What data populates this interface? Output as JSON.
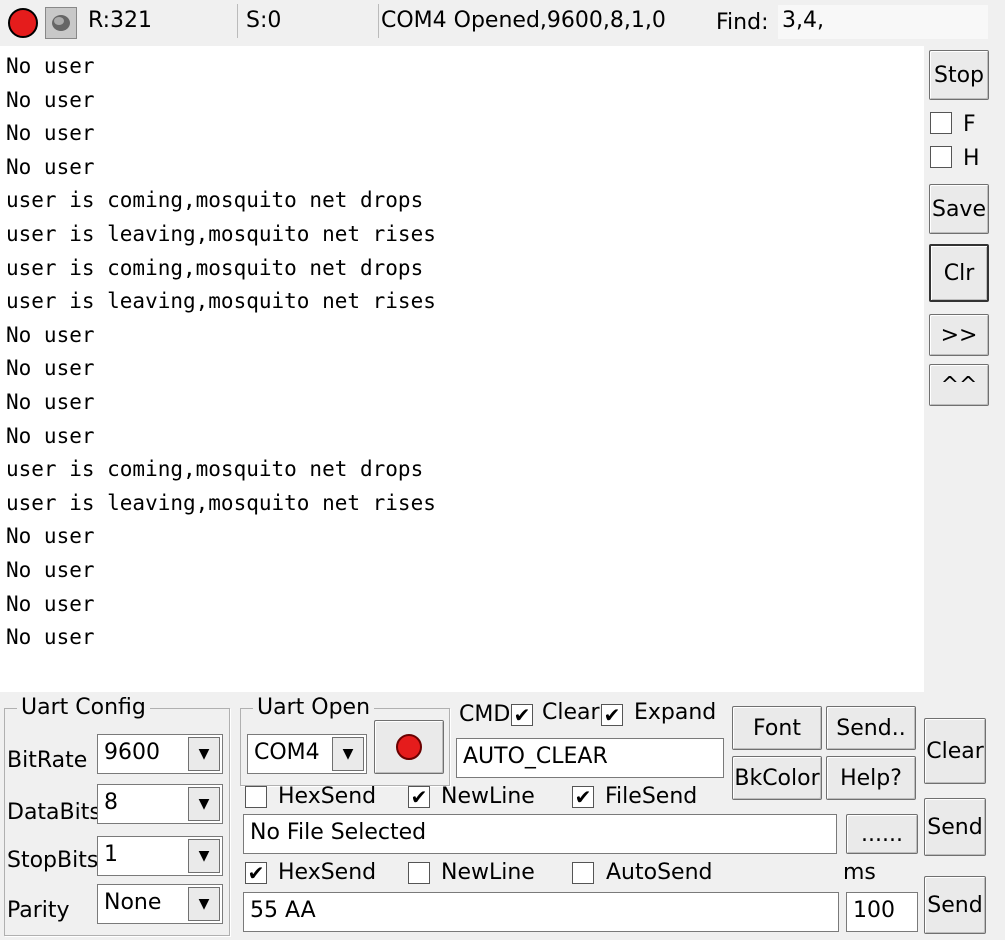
{
  "status_bar": {
    "received": "R:321",
    "sent": "S:0",
    "port_status": "COM4 Opened,9600,8,1,0",
    "find_label": "Find:",
    "find_value": "3,4,"
  },
  "log": {
    "lines": [
      "No user",
      "No user",
      "No user",
      "No user",
      "user is coming,mosquito net drops",
      "user is leaving,mosquito net rises",
      "user is coming,mosquito net drops",
      "user is leaving,mosquito net rises",
      "No user",
      "No user",
      "No user",
      "No user",
      "user is coming,mosquito net drops",
      "user is leaving,mosquito net rises",
      "No user",
      "No user",
      "No user",
      "No user"
    ]
  },
  "side_panel": {
    "stop_label": "Stop",
    "f_label": "F",
    "f_checked": false,
    "h_label": "H",
    "h_checked": false,
    "save_label": "Save",
    "clr_label": "Clr",
    "forward_label": ">>",
    "up_label": "^^"
  },
  "uart_config": {
    "title": "Uart Config",
    "bitrate_label": "BitRate",
    "bitrate_value": "9600",
    "databits_label": "DataBits",
    "databits_value": "8",
    "stopbits_label": "StopBits",
    "stopbits_value": "1",
    "parity_label": "Parity",
    "parity_value": "None"
  },
  "uart_open": {
    "title": "Uart Open",
    "port_value": "COM4"
  },
  "cmd": {
    "cmd_label": "CMD",
    "cmd_checked": true,
    "clear_label": "Clear",
    "clear_checked": true,
    "expand_label": "Expand",
    "expand_checked": false,
    "cmd_value": "AUTO_CLEAR",
    "font_label": "Font",
    "send_dialog_label": "Send..",
    "bkcolor_label": "BkColor",
    "help_label": "Help?"
  },
  "file_row": {
    "hexsend_label": "HexSend",
    "hexsend_checked": false,
    "newline_label": "NewLine",
    "newline_checked": true,
    "filesend_label": "FileSend",
    "filesend_checked": true,
    "file_value": "No File Selected",
    "browse_label": "......"
  },
  "send_row": {
    "hexsend_label": "HexSend",
    "hexsend_checked": true,
    "newline_label": "NewLine",
    "newline_checked": false,
    "autosend_label": "AutoSend",
    "autosend_checked": false,
    "ms_label": "ms",
    "data_value": "55 AA",
    "interval_value": "100"
  },
  "right_buttons": {
    "clear_label": "Clear",
    "send_file_label": "Send",
    "send_data_label": "Send"
  }
}
